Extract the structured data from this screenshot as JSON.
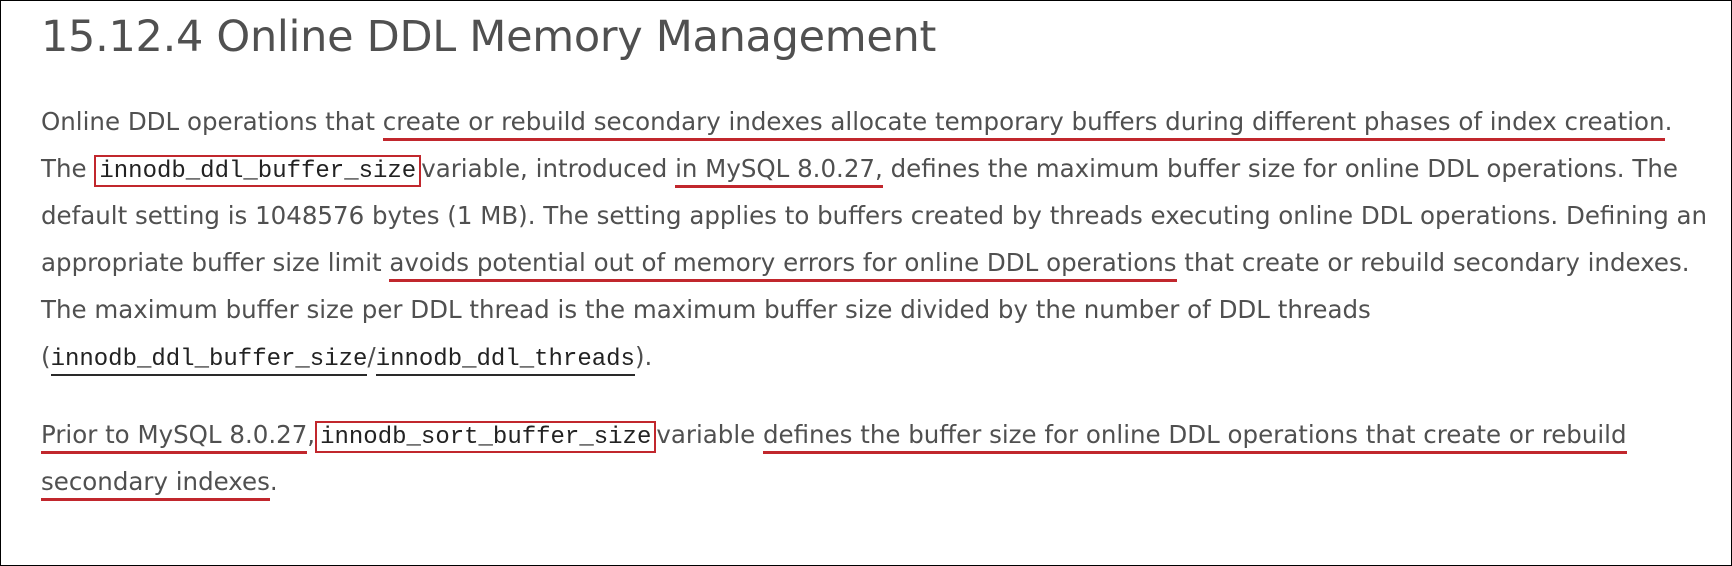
{
  "heading": "15.12.4 Online DDL Memory Management",
  "paragraph1": {
    "line1": {
      "prefix": "Online DDL operations that ",
      "highlight": "create or rebuild secondary indexes allocate temporary buffers during different phases of index creation",
      "suffix": "."
    },
    "line2": {
      "prefix": "The ",
      "code": "innodb_ddl_buffer_size",
      "middle": "variable, introduced ",
      "highlight": "in MySQL 8.0.27,",
      "suffix": " defines the maximum buffer size for online DDL operations. The"
    },
    "line3": "default setting is 1048576 bytes (1 MB). The setting applies to buffers created by threads executing online DDL operations. Defining an",
    "line4": {
      "prefix": "appropriate buffer size limit ",
      "highlight": "avoids potential out of memory errors for online DDL operations",
      "suffix": " that create or rebuild secondary indexes."
    },
    "line5": "The maximum buffer size per DDL thread is the maximum buffer size divided by the number of DDL threads",
    "line6": {
      "open": "(",
      "code1": "innodb_ddl_buffer_size",
      "slash": "/",
      "code2": "innodb_ddl_threads",
      "close": ")."
    }
  },
  "paragraph2": {
    "line1": {
      "highlight1": "Prior to MySQL 8.0.27",
      "comma": ",",
      "code": "innodb_sort_buffer_size",
      "middle": "variable ",
      "highlight2": "defines the buffer size for online DDL operations that create or rebuild"
    },
    "line2": {
      "highlight": "secondary indexes",
      "suffix": "."
    }
  },
  "colors": {
    "annotation_red": "#c1272d",
    "body_text": "#505050",
    "code_text": "#222222"
  }
}
